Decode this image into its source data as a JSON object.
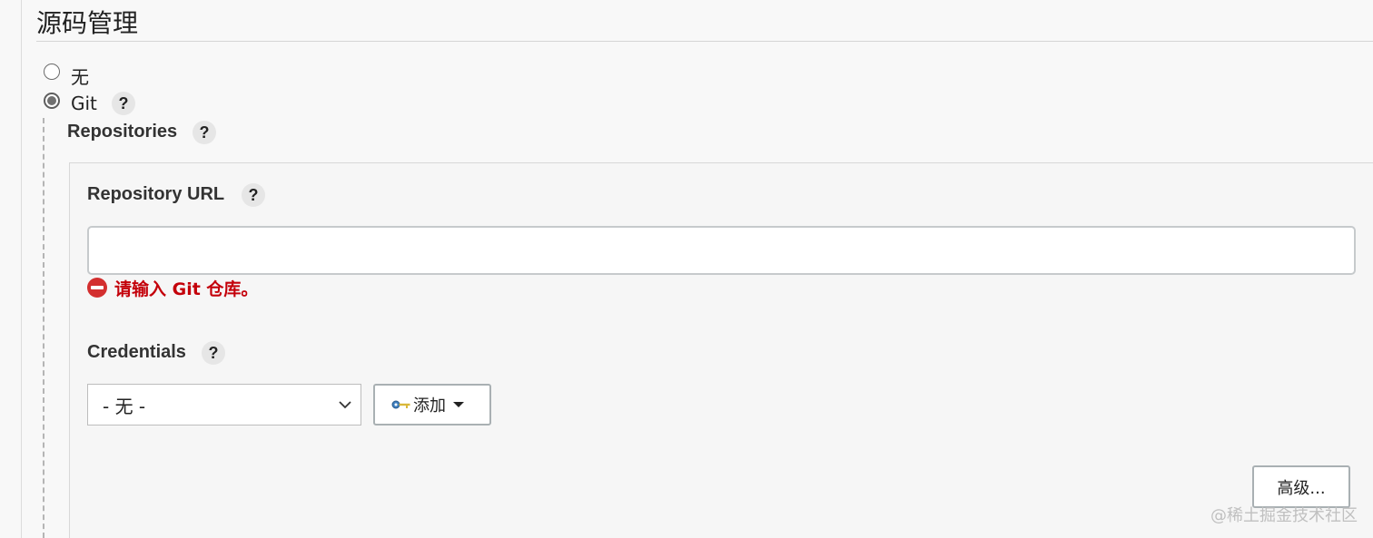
{
  "section": {
    "title": "源码管理"
  },
  "scm_options": [
    {
      "label": "无",
      "selected": false
    },
    {
      "label": "Git",
      "selected": true
    }
  ],
  "help_label": "?",
  "repositories": {
    "label": "Repositories",
    "repository_url": {
      "label": "Repository URL",
      "value": "",
      "error": "请输入 Git 仓库。"
    },
    "credentials": {
      "label": "Credentials",
      "selected": "- 无 -",
      "add_button": "添加"
    },
    "advanced_button": "高级..."
  },
  "watermark": "@稀土掘金技术社区",
  "colors": {
    "error": "#c4000a",
    "error_icon": "#d32f2f",
    "background": "#f8f8f8"
  }
}
